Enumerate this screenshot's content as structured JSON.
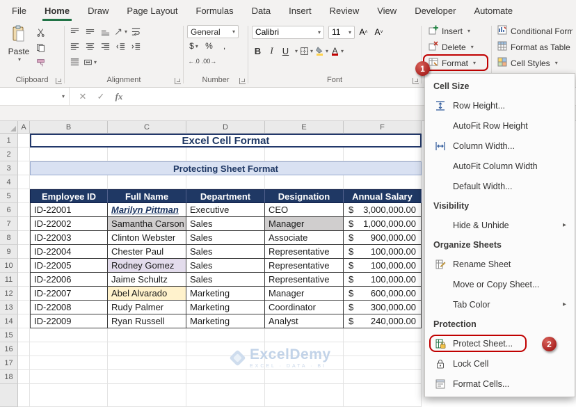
{
  "ribbon": {
    "tabs": [
      "File",
      "Home",
      "Draw",
      "Page Layout",
      "Formulas",
      "Data",
      "Insert",
      "Review",
      "View",
      "Developer",
      "Automate"
    ],
    "active_tab": "Home",
    "clipboard": {
      "group_label": "Clipboard",
      "paste_label": "Paste"
    },
    "alignment": {
      "group_label": "Alignment"
    },
    "number": {
      "group_label": "Number",
      "format_value": "General",
      "currency": "$",
      "percent": "%",
      "comma": ",",
      "increase_decimal": "←.0",
      "decrease_decimal": ".00→"
    },
    "font": {
      "group_label": "Font",
      "font_name": "Calibri",
      "font_size": "11",
      "bold": "B",
      "italic": "I",
      "underline": "U",
      "grow_letter": "A",
      "shrink_letter": "A",
      "color_letter": "A"
    },
    "cells": {
      "insert_label": "Insert",
      "delete_label": "Delete",
      "format_label": "Format"
    },
    "styles": {
      "conditional_label": "Conditional Form",
      "format_table_label": "Format as Table",
      "cell_styles_label": "Cell Styles"
    }
  },
  "formula_bar": {
    "name_box": "",
    "cancel_icon": "✕",
    "enter_icon": "✓",
    "fx_label": "fx"
  },
  "annotations": {
    "step1": "1",
    "step2": "2"
  },
  "format_menu": {
    "sections": [
      {
        "header": "Cell Size",
        "items": [
          {
            "label": "Row Height...",
            "icon": "row-height-icon"
          },
          {
            "label": "AutoFit Row Height"
          },
          {
            "label": "Column Width...",
            "icon": "column-width-icon"
          },
          {
            "label": "AutoFit Column Width"
          },
          {
            "label": "Default Width..."
          }
        ]
      },
      {
        "header": "Visibility",
        "items": [
          {
            "label": "Hide & Unhide",
            "submenu": true
          }
        ]
      },
      {
        "header": "Organize Sheets",
        "items": [
          {
            "label": "Rename Sheet",
            "icon": "rename-sheet-icon"
          },
          {
            "label": "Move or Copy Sheet..."
          },
          {
            "label": "Tab Color",
            "submenu": true
          }
        ]
      },
      {
        "header": "Protection",
        "items": [
          {
            "label": "Protect Sheet...",
            "icon": "protect-sheet-icon",
            "highlighted": true
          },
          {
            "label": "Lock Cell",
            "icon": "lock-cell-icon"
          },
          {
            "label": "Format Cells...",
            "icon": "format-cells-icon"
          }
        ]
      }
    ]
  },
  "sheet": {
    "columns": [
      "A",
      "B",
      "C",
      "D",
      "E",
      "F"
    ],
    "rows": [
      "1",
      "2",
      "3",
      "4",
      "5",
      "6",
      "7",
      "8",
      "9",
      "10",
      "11",
      "12",
      "13",
      "14",
      "15",
      "16",
      "17",
      "18"
    ],
    "title": "Excel Cell Format",
    "subtitle": "Protecting Sheet Format",
    "table": {
      "headers": [
        "Employee ID",
        "Full Name",
        "Department",
        "Designation",
        "Annual Salary"
      ],
      "rows": [
        {
          "id": "ID-22001",
          "name": "Marilyn Pittman",
          "department": "Executive",
          "designation": "CEO",
          "currency": "$",
          "amount": "3,000,000.00"
        },
        {
          "id": "ID-22002",
          "name": "Samantha Carson",
          "department": "Sales",
          "designation": "Manager",
          "currency": "$",
          "amount": "1,000,000.00"
        },
        {
          "id": "ID-22003",
          "name": "Clinton Webster",
          "department": "Sales",
          "designation": "Associate",
          "currency": "$",
          "amount": "900,000.00"
        },
        {
          "id": "ID-22004",
          "name": "Chester Paul",
          "department": "Sales",
          "designation": "Representative",
          "currency": "$",
          "amount": "100,000.00"
        },
        {
          "id": "ID-22005",
          "name": "Rodney Gomez",
          "department": "Sales",
          "designation": "Representative",
          "currency": "$",
          "amount": "100,000.00"
        },
        {
          "id": "ID-22006",
          "name": "Jaime Schultz",
          "department": "Sales",
          "designation": "Representative",
          "currency": "$",
          "amount": "100,000.00"
        },
        {
          "id": "ID-22007",
          "name": "Abel Alvarado",
          "department": "Marketing",
          "designation": "Manager",
          "currency": "$",
          "amount": "600,000.00"
        },
        {
          "id": "ID-22008",
          "name": "Rudy Palmer",
          "department": "Marketing",
          "designation": "Coordinator",
          "currency": "$",
          "amount": "300,000.00"
        },
        {
          "id": "ID-22009",
          "name": "Ryan Russell",
          "department": "Marketing",
          "designation": "Analyst",
          "currency": "$",
          "amount": "240,000.00"
        }
      ]
    },
    "watermark": {
      "brand": "ExcelDemy",
      "tagline": "EXCEL · DATA · BI"
    }
  },
  "colors": {
    "accent_green": "#217346",
    "navy": "#1F3864",
    "annotation_red": "#C00000",
    "subtitle_bg": "#D9E1F2",
    "highlight_gray": "#D0CECE",
    "highlight_lavender": "#E3DCEC",
    "highlight_cream": "#FFF2CC"
  }
}
